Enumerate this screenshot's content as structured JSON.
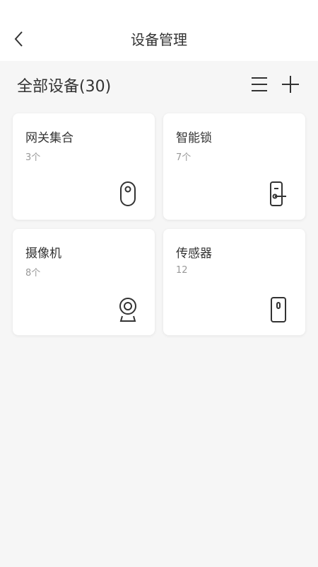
{
  "header": {
    "title": "设备管理",
    "back_icon": "chevron-left-icon"
  },
  "section": {
    "title": "全部设备(30)",
    "list_icon": "list-icon",
    "add_icon": "plus-icon"
  },
  "devices": [
    {
      "name": "网关集合",
      "count": "3个",
      "icon": "gateway-icon"
    },
    {
      "name": "智能锁",
      "count": "7个",
      "icon": "smart-lock-icon"
    },
    {
      "name": "摄像机",
      "count": "8个",
      "icon": "camera-icon"
    },
    {
      "name": "传感器",
      "count": "12",
      "icon": "sensor-icon"
    }
  ],
  "colors": {
    "background": "#f6f6f6",
    "card": "#ffffff",
    "text": "#333333",
    "muted": "#999999"
  }
}
